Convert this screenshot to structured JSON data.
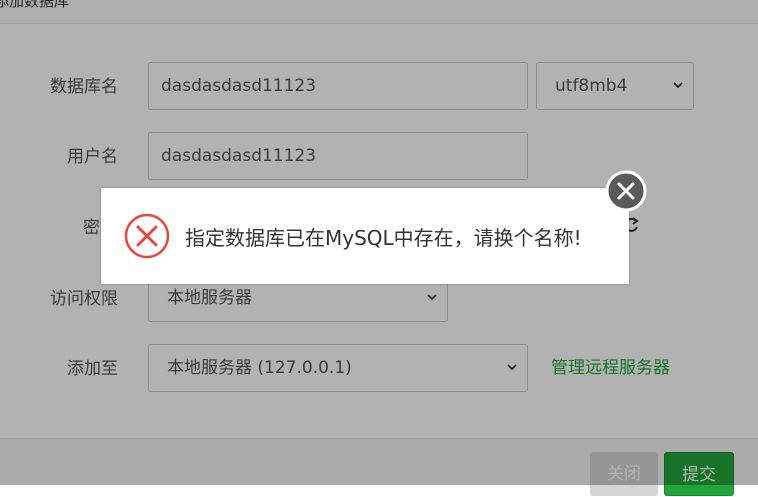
{
  "dialog": {
    "title": "添加数据库"
  },
  "form": {
    "db_name_label": "数据库名",
    "db_name_value": "dasdasdasd11123",
    "charset_value": "utf8mb4",
    "username_label": "用户名",
    "username_value": "dasdasdasd11123",
    "password_label_partial": "密",
    "access_label": "访问权限",
    "access_value": "本地服务器",
    "add_to_label": "添加至",
    "add_to_value": "本地服务器 (127.0.0.1)",
    "manage_remote_link": "管理远程服务器"
  },
  "footer": {
    "close_label": "关闭",
    "submit_label": "提交"
  },
  "toast": {
    "message": "指定数据库已在MySQL中存在，请换个名称!"
  },
  "colors": {
    "accent_green": "#20a53a",
    "error_red": "#e8483b"
  }
}
